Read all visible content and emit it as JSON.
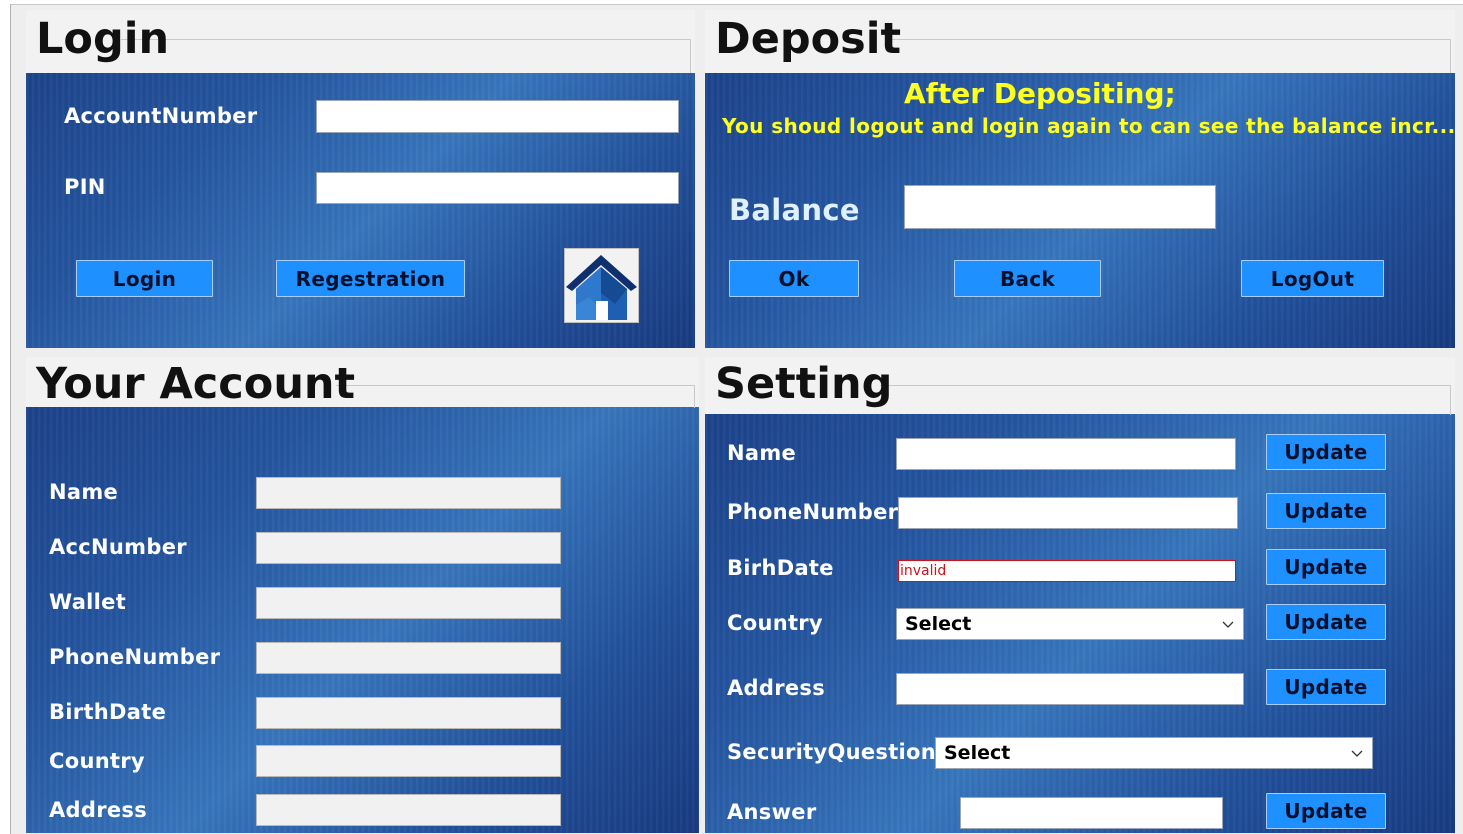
{
  "login": {
    "title": "Login",
    "account_number_label": "AccountNumber",
    "pin_label": "PIN",
    "login_button": "Login",
    "registration_button": "Regestration"
  },
  "deposit": {
    "title": "Deposit",
    "notice_heading": "After Depositing;",
    "notice_text": "You shoud logout and login again to can see the balance incr...",
    "balance_label": "Balance",
    "ok_button": "Ok",
    "back_button": "Back",
    "logout_button": "LogOut"
  },
  "account": {
    "title": "Your Account",
    "fields": {
      "name": "Name",
      "acc_number": "AccNumber",
      "wallet": "Wallet",
      "phone_number": "PhoneNumber",
      "birth_date": "BirthDate",
      "country": "Country",
      "address": "Address"
    }
  },
  "setting": {
    "title": "Setting",
    "name_label": "Name",
    "phone_label": "PhoneNumber",
    "birthdate_label": "BirhDate",
    "birthdate_value": "invalid",
    "country_label": "Country",
    "country_selected": "Select",
    "address_label": "Address",
    "security_question_label": "SecurityQuestion",
    "security_question_selected": "Select",
    "answer_label": "Answer",
    "update_button": "Update"
  },
  "colors": {
    "button": "#1e90ff",
    "notice": "#ffff22",
    "invalid": "#d0101a",
    "panel": "#24549e"
  }
}
